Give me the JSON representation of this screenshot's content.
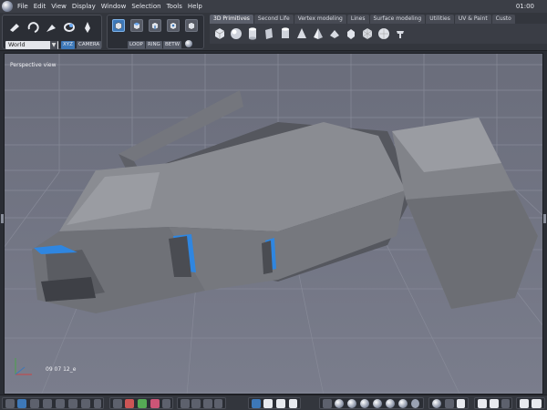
{
  "menubar": {
    "items": [
      "File",
      "Edit",
      "View",
      "Display",
      "Window",
      "Selection",
      "Tools",
      "Help"
    ],
    "clock": "01:00"
  },
  "toolbar": {
    "world_select": "World",
    "coord_buttons": [
      "XYZ",
      "CAMERA"
    ],
    "select_modes": [
      "LOOP",
      "RING",
      "BETW"
    ],
    "tabs": [
      "3D Primitives",
      "Second Life",
      "Vertex modeling",
      "Lines",
      "Surface modeling",
      "Utilities",
      "UV & Paint",
      "Custo"
    ],
    "active_tab": "3D Primitives",
    "primitives": [
      "cube-icon",
      "sphere-icon",
      "cylinder-icon",
      "plane-icon",
      "tube-icon",
      "cone-icon",
      "pyramid-icon",
      "prism-icon",
      "torus-icon",
      "icosahedron-icon",
      "geosphere-icon",
      "teapot-icon"
    ]
  },
  "viewport": {
    "label": "Perspective view",
    "code": "09 07 12_e"
  },
  "colors": {
    "accent": "#3d78b8",
    "viewport_bg": "#6f7282",
    "grid": "#8b8e9c",
    "model": "#7a7c82",
    "glow": "#2f86e0"
  }
}
